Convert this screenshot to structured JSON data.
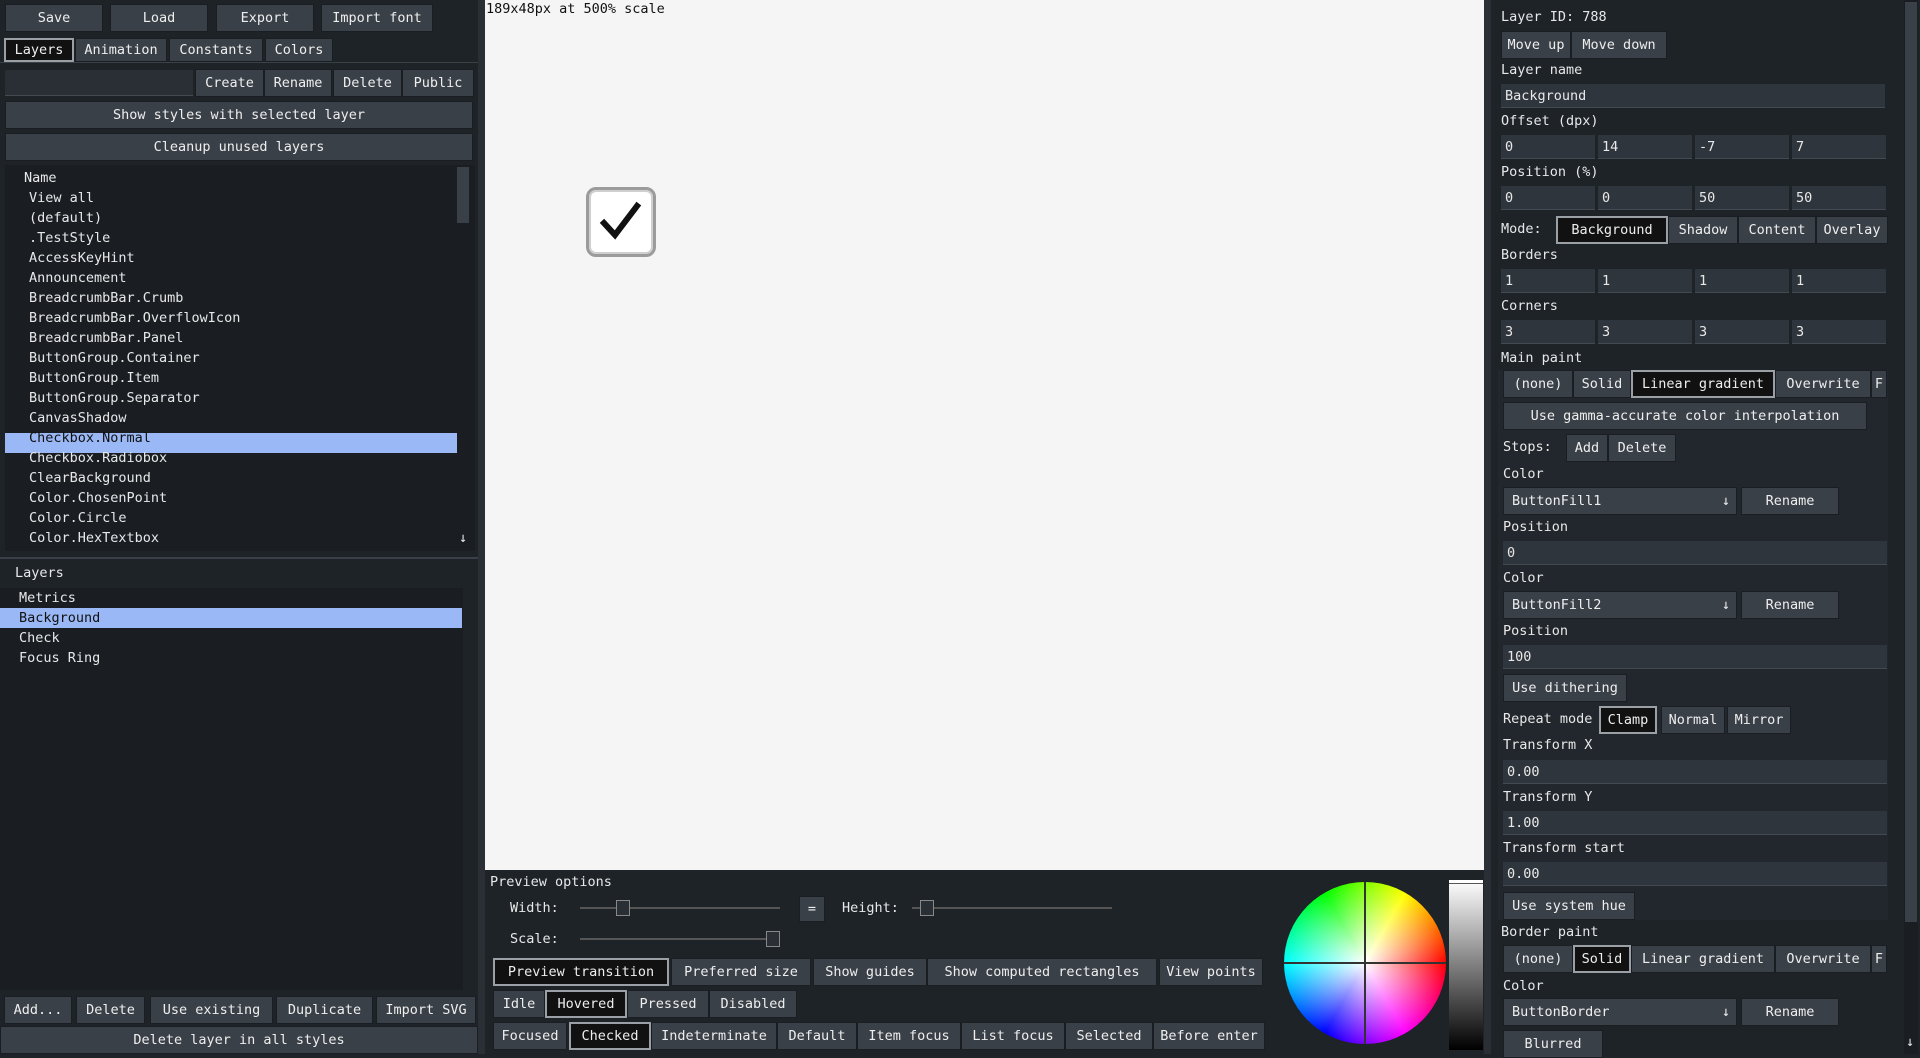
{
  "toolbar": {
    "save": "Save",
    "load": "Load",
    "export": "Export",
    "import_font": "Import font"
  },
  "tabs": [
    "Layers",
    "Animation",
    "Constants",
    "Colors"
  ],
  "style_actions": {
    "create": "Create",
    "rename": "Rename",
    "delete": "Delete",
    "public": "Public",
    "show_styles": "Show styles with selected layer",
    "cleanup": "Cleanup unused layers"
  },
  "styles_list": {
    "header": "Name",
    "selected_index": 12,
    "items": [
      "View all",
      "(default)",
      ".TestStyle",
      "AccessKeyHint",
      "Announcement",
      "BreadcrumbBar.Crumb",
      "BreadcrumbBar.OverflowIcon",
      "BreadcrumbBar.Panel",
      "ButtonGroup.Container",
      "ButtonGroup.Item",
      "ButtonGroup.Separator",
      "CanvasShadow",
      "Checkbox.Normal",
      "Checkbox.Radiobox",
      "ClearBackground",
      "Color.ChosenPoint",
      "Color.Circle",
      "Color.HexTextbox"
    ],
    "scroll_arrow": "↓"
  },
  "layers_list": {
    "header": "Layers",
    "selected_index": 1,
    "items": [
      "Metrics",
      "Background",
      "Check",
      "Focus Ring"
    ]
  },
  "layer_actions": {
    "add": "Add...",
    "delete": "Delete",
    "use_existing": "Use existing",
    "duplicate": "Duplicate",
    "import_svg": "Import SVG",
    "delete_all": "Delete layer in all styles"
  },
  "preview": {
    "info": "189x48px at 500% scale",
    "options_title": "Preview options",
    "width_label": "Width:",
    "equals": "=",
    "height_label": "Height:",
    "scale_label": "Scale:",
    "toggles": [
      "Preview transition",
      "Preferred size",
      "Show guides",
      "Show computed rectangles",
      "View points"
    ],
    "states": [
      "Idle",
      "Hovered",
      "Pressed",
      "Disabled"
    ],
    "flags": [
      "Focused",
      "Checked",
      "Indeterminate",
      "Default",
      "Item focus",
      "List focus",
      "Selected",
      "Before enter"
    ]
  },
  "props": {
    "layer_id": "Layer ID: 788",
    "move_up": "Move up",
    "move_down": "Move down",
    "layer_name_label": "Layer name",
    "layer_name": "Background",
    "offset_label": "Offset (dpx)",
    "offset": [
      "0",
      "14",
      "-7",
      "7"
    ],
    "position_label": "Position (%)",
    "position": [
      "0",
      "0",
      "50",
      "50"
    ],
    "mode_label": "Mode:",
    "modes": [
      "Background",
      "Shadow",
      "Content",
      "Overlay"
    ],
    "borders_label": "Borders",
    "borders": [
      "1",
      "1",
      "1",
      "1"
    ],
    "corners_label": "Corners",
    "corners": [
      "3",
      "3",
      "3",
      "3"
    ],
    "main_paint_label": "Main paint",
    "paint_types": [
      "(none)",
      "Solid",
      "Linear gradient",
      "Overwrite",
      "F"
    ],
    "gamma": "Use gamma-accurate color interpolation",
    "stops_label": "Stops:",
    "stops_add": "Add",
    "stops_delete": "Delete",
    "color_label": "Color",
    "stop1_color": "ButtonFill1",
    "rename": "Rename",
    "position_single_label": "Position",
    "stop1_pos": "0",
    "stop2_color": "ButtonFill2",
    "stop2_pos": "100",
    "dithering": "Use dithering",
    "repeat_label": "Repeat mode",
    "repeat_modes": [
      "Clamp",
      "Normal",
      "Mirror"
    ],
    "tx_label": "Transform X",
    "tx": "0.00",
    "ty_label": "Transform Y",
    "ty": "1.00",
    "tstart_label": "Transform start",
    "tstart": "0.00",
    "system_hue": "Use system hue",
    "border_paint_label": "Border paint",
    "border_color": "ButtonBorder",
    "blurred": "Blurred",
    "dropdown_arrow": "↓"
  }
}
